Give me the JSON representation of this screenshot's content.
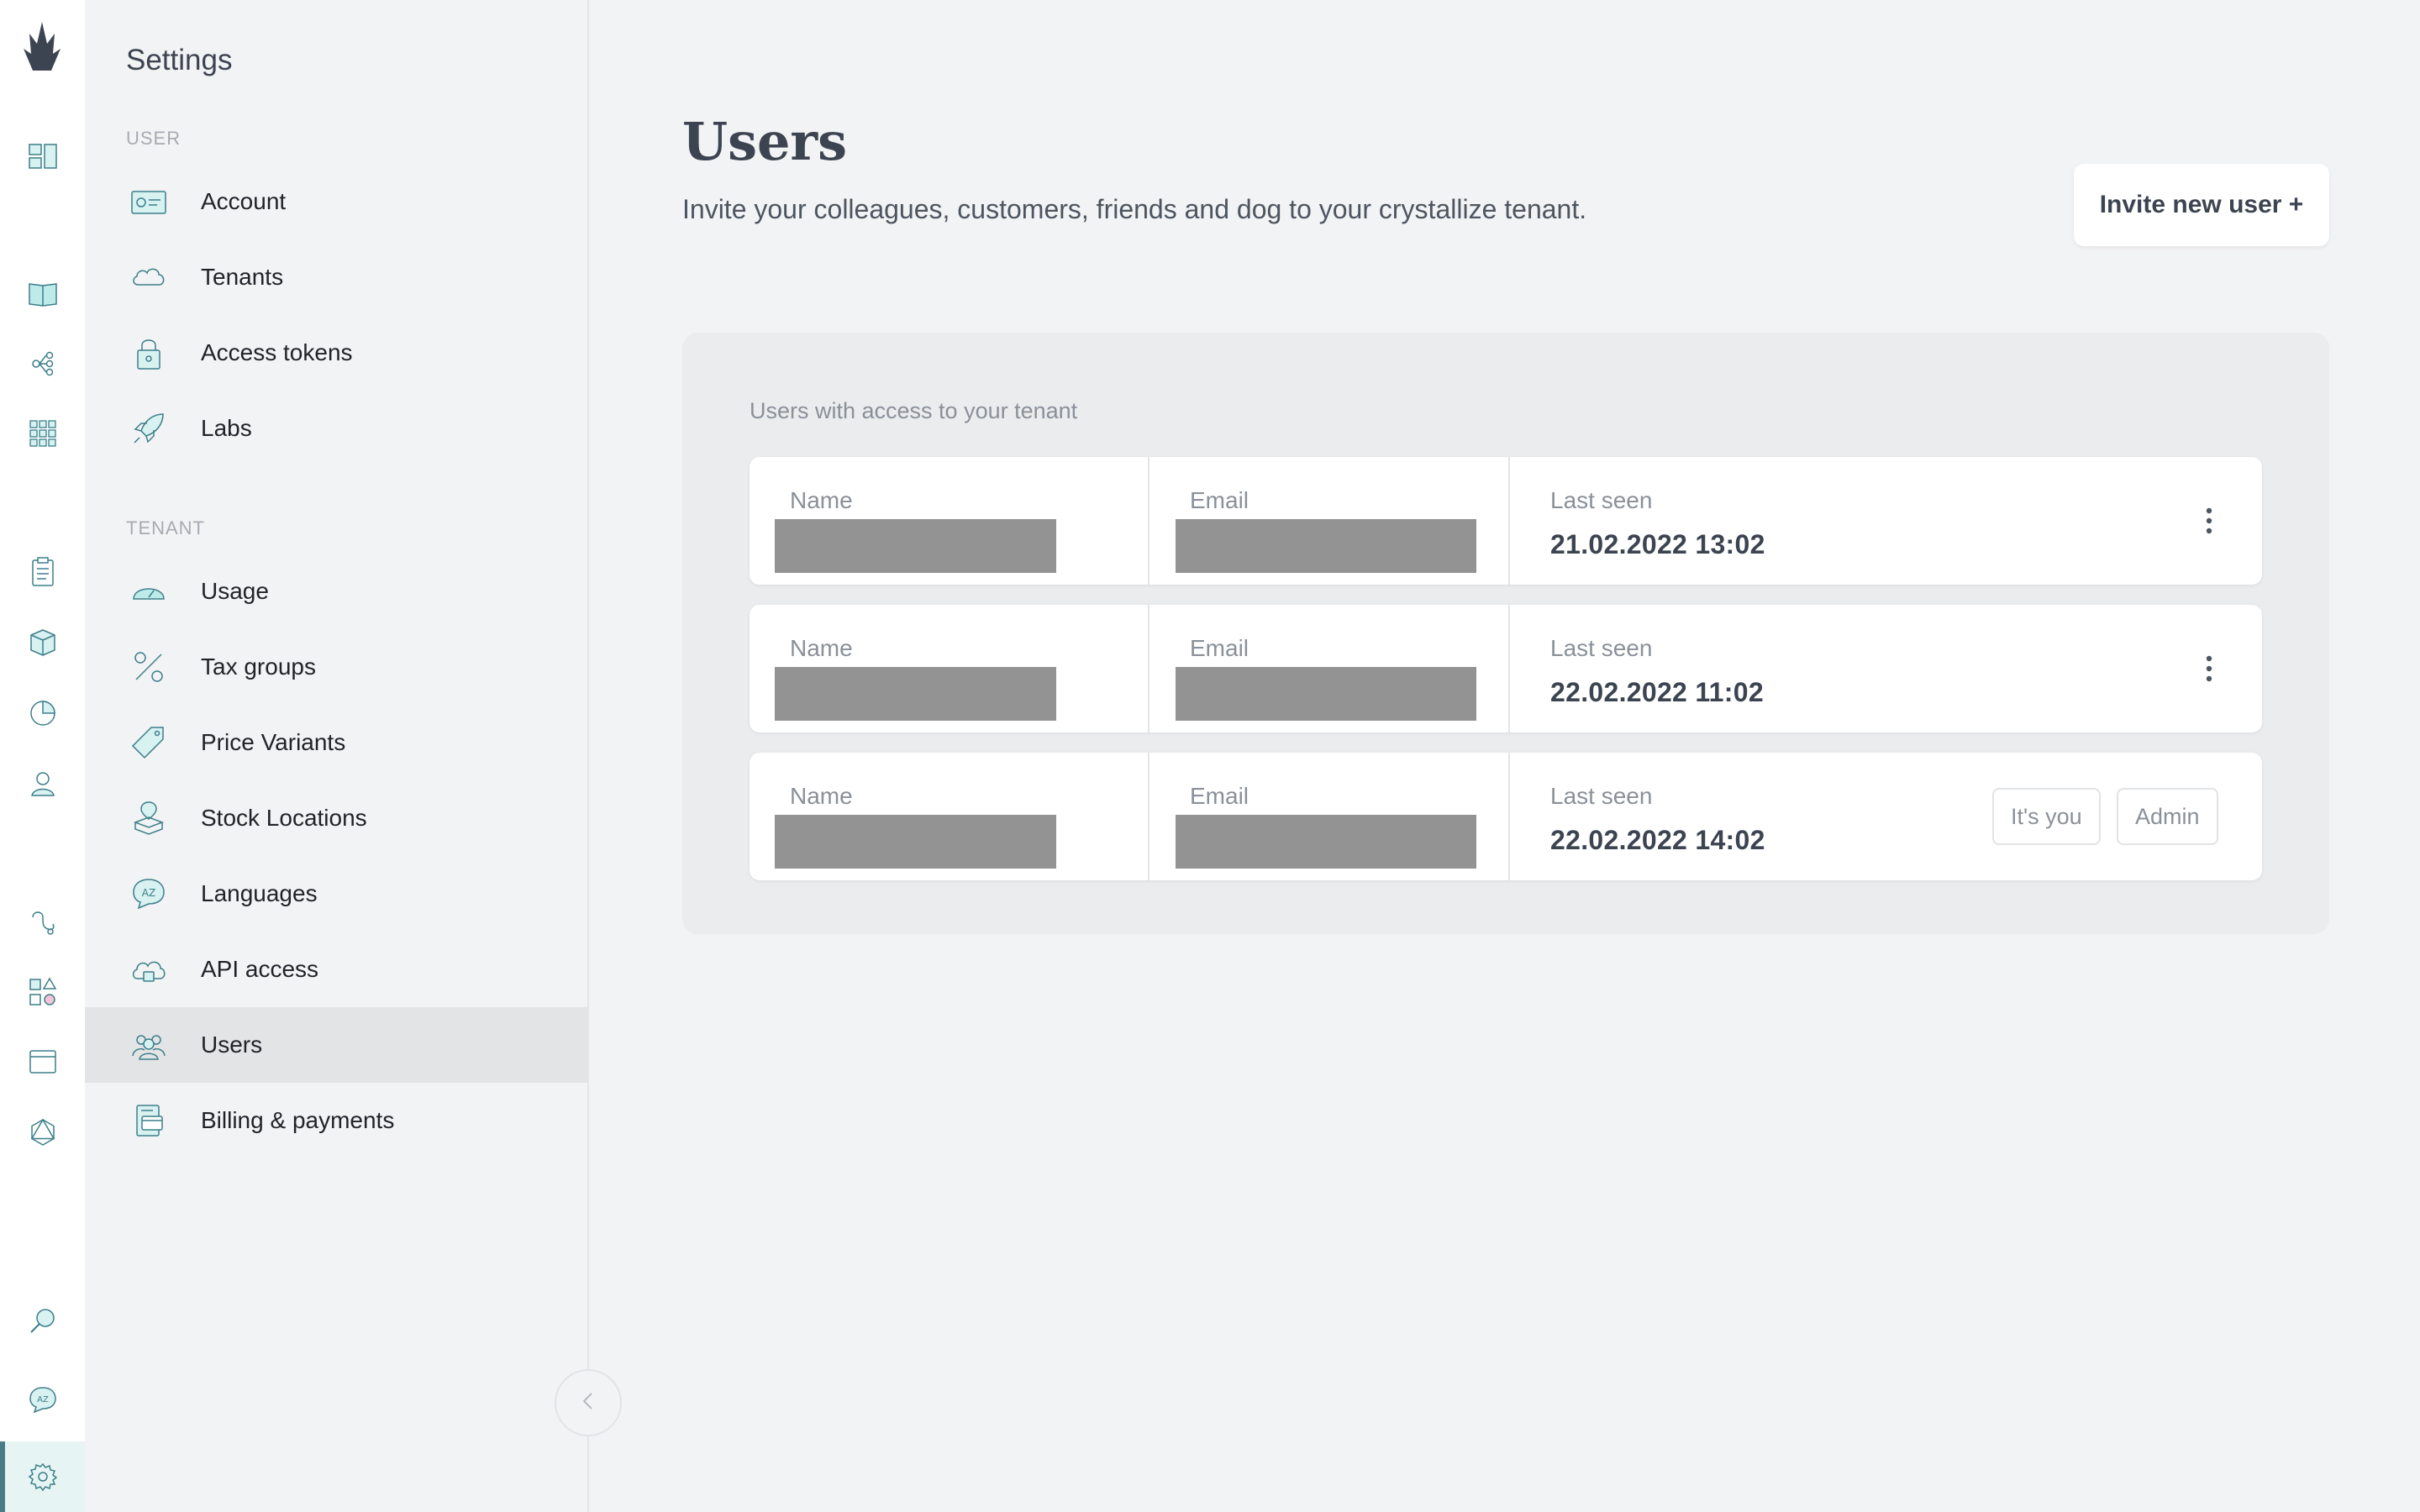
{
  "sidebar": {
    "title": "Settings",
    "sections": {
      "user_label": "USER",
      "tenant_label": "TENANT"
    },
    "user_items": [
      {
        "label": "Account",
        "icon": "id-card-icon"
      },
      {
        "label": "Tenants",
        "icon": "cloud-icon"
      },
      {
        "label": "Access tokens",
        "icon": "lock-icon"
      },
      {
        "label": "Labs",
        "icon": "rocket-icon"
      }
    ],
    "tenant_items": [
      {
        "label": "Usage",
        "icon": "gauge-icon"
      },
      {
        "label": "Tax groups",
        "icon": "percent-icon"
      },
      {
        "label": "Price Variants",
        "icon": "price-tag-icon"
      },
      {
        "label": "Stock Locations",
        "icon": "stock-location-icon"
      },
      {
        "label": "Languages",
        "icon": "language-icon"
      },
      {
        "label": "API access",
        "icon": "api-cloud-icon"
      },
      {
        "label": "Users",
        "icon": "users-icon",
        "active": true
      },
      {
        "label": "Billing & payments",
        "icon": "billing-icon"
      }
    ]
  },
  "main": {
    "title": "Users",
    "subtitle": "Invite your colleagues, customers, friends and dog to your crystallize tenant.",
    "invite_button": "Invite new user +",
    "panel_title": "Users with access to your tenant",
    "columns": {
      "name": "Name",
      "email": "Email",
      "last_seen": "Last seen"
    },
    "users": [
      {
        "last_seen": "21.02.2022 13:02",
        "actions": "menu"
      },
      {
        "last_seen": "22.02.2022 11:02",
        "actions": "menu"
      },
      {
        "last_seen": "22.02.2022 14:02",
        "badges": [
          "It's you",
          "Admin"
        ]
      }
    ]
  },
  "colors": {
    "accent": "#4ec3c3",
    "icon_stroke": "#3c7f8a",
    "background": "#f2f3f4"
  }
}
